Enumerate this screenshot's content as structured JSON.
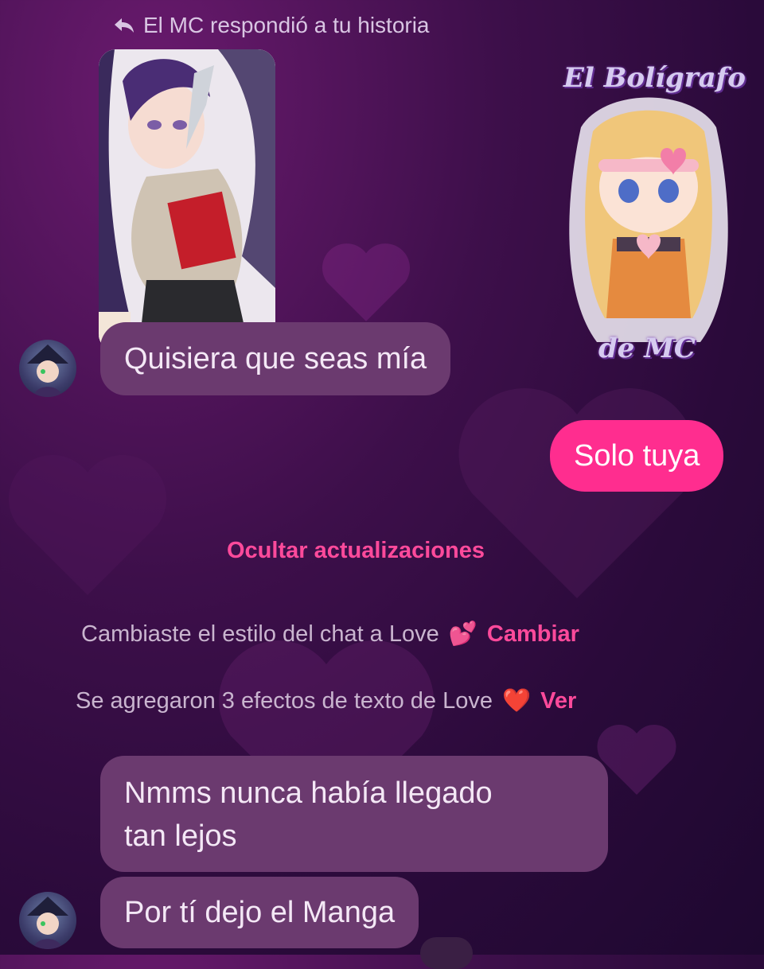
{
  "reply_header": {
    "text": "El MC respondió a tu historia"
  },
  "watermark": {
    "line1": "El Bolígrafo",
    "line2": "de MC"
  },
  "messages": [
    {
      "id": "m1",
      "text": "Quisiera que seas mía",
      "direction": "incoming"
    },
    {
      "id": "m2",
      "text": "Solo tuya",
      "direction": "outgoing"
    },
    {
      "id": "m3",
      "text_line1": "Nmms nunca había llegado",
      "text_line2": "tan lejos",
      "direction": "incoming"
    },
    {
      "id": "m4",
      "text": "Por tí dejo el Manga",
      "direction": "incoming"
    }
  ],
  "system": {
    "hide_updates": "Ocultar actualizaciones",
    "style_notice": {
      "text": "Cambiaste el estilo del chat a Love",
      "emoji": "💕",
      "action": "Cambiar"
    },
    "effects_notice": {
      "text": "Se agregaron 3 efectos de texto de Love",
      "emoji": "❤️",
      "action": "Ver"
    }
  },
  "colors": {
    "incoming_bubble": "#6b3a6f",
    "outgoing_bubble": "#ff2d8f",
    "accent": "#ff4a9b"
  }
}
